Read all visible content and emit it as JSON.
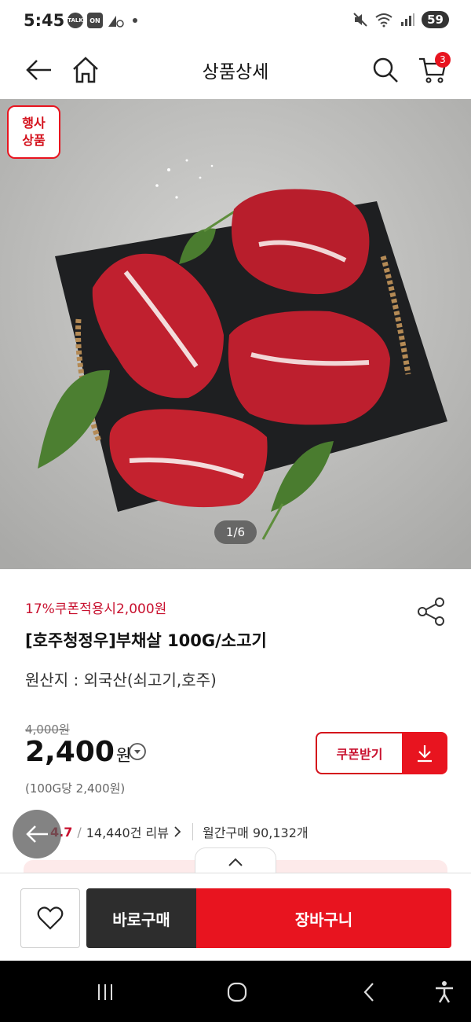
{
  "status_bar": {
    "time": "5:45",
    "left_icons": [
      "TALK",
      "ON"
    ],
    "battery": "59"
  },
  "header": {
    "title": "상품상세",
    "cart_count": "3"
  },
  "hero": {
    "badge": "행사\n상품",
    "page_indicator": "1/6"
  },
  "product": {
    "coupon_promo": "17%쿠폰적용시2,000원",
    "name": "[호주청정우]부채살 100G/소고기",
    "origin": "원산지 : 외국산(쇠고기,호주)",
    "original_price": "4,000원",
    "price": "2,400",
    "price_unit": "원",
    "unit_price": "(100G당 2,400원)",
    "coupon_button": "쿠폰받기"
  },
  "reviews": {
    "rating": "4.7",
    "separator": "/",
    "review_count": "14,440건 리뷰",
    "monthly_purchases": "월간구매 90,132개"
  },
  "actions": {
    "buy_now": "바로구매",
    "add_to_cart": "장바구니"
  },
  "colors": {
    "accent": "#e8141f",
    "dark_button": "#2d2d2d",
    "promo_text": "#c8102e"
  }
}
